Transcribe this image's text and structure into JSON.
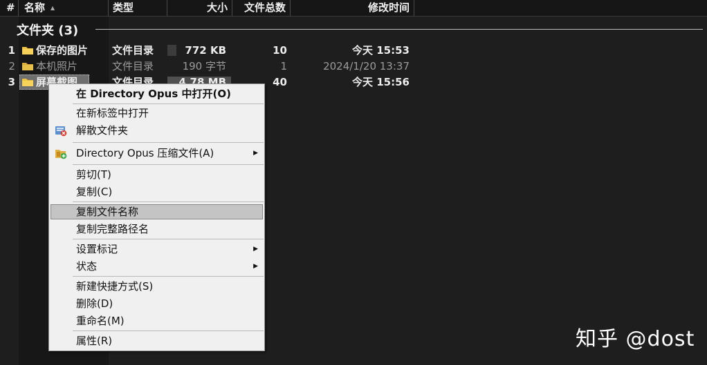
{
  "header": {
    "index": "#",
    "name": "名称",
    "type": "类型",
    "size": "大小",
    "count": "文件总数",
    "modified": "修改时间"
  },
  "group": {
    "title": "文件夹 (3)"
  },
  "rows": [
    {
      "num": "1",
      "name": "保存的图片",
      "type": "文件目录",
      "size": "772 KB",
      "count": "10",
      "date": "今天  15:53"
    },
    {
      "num": "2",
      "name": "本机照片",
      "type": "文件目录",
      "size": "190 字节",
      "count": "1",
      "date": "2024/1/20  13:37"
    },
    {
      "num": "3",
      "name": "屏幕截图",
      "type": "文件目录",
      "size": "4.78 MB",
      "count": "40",
      "date": "今天  15:56"
    }
  ],
  "menu": {
    "open_in_dopus": "在 Directory Opus 中打开(O)",
    "open_new_tab": "在新标签中打开",
    "dissolve_folder": "解散文件夹",
    "dopus_compress": "Directory Opus 压缩文件(A)",
    "cut": "剪切(T)",
    "copy": "复制(C)",
    "copy_filename": "复制文件名称",
    "copy_fullpath": "复制完整路径名",
    "set_label": "设置标记",
    "status": "状态",
    "new_shortcut": "新建快捷方式(S)",
    "delete": "删除(D)",
    "rename": "重命名(M)",
    "properties": "属性(R)"
  },
  "watermark": "知乎 @dost",
  "colors": {
    "folder": "#f0c040",
    "highlight": "#c4c4c4",
    "background": "#1e1e1e"
  }
}
